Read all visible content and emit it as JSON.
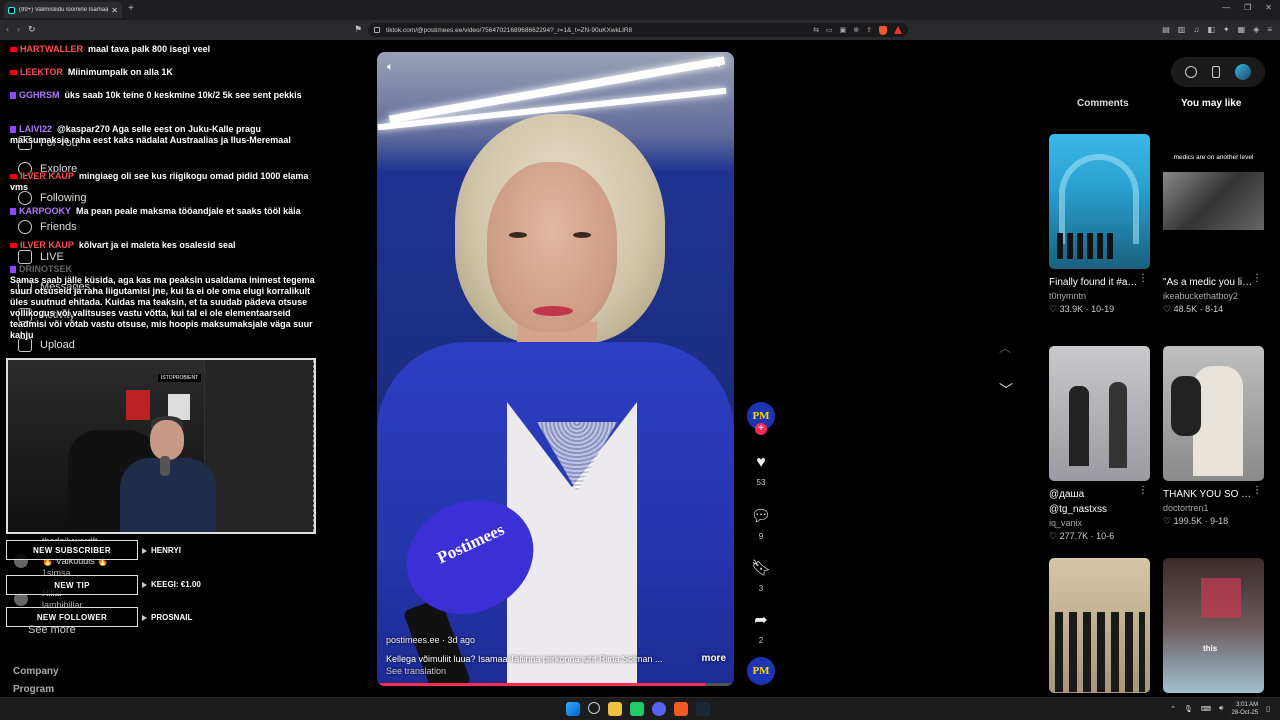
{
  "browser": {
    "tab_title": "(99+) Valimisliidu loomine Isamaa...",
    "url": "tiktok.com/@postimees.ee/video/7564702168968662294?_r=1&_t=ZN-90uKXwkLlR8"
  },
  "sidebar": {
    "items": [
      "For You",
      "Explore",
      "Following",
      "Friends",
      "LIVE",
      "Messages",
      "Activity",
      "Upload"
    ],
    "see_more": "See more",
    "footer": [
      "Company",
      "Program"
    ]
  },
  "chat": [
    {
      "user": "HARTWALLER",
      "text": "maal tava palk 800 isegi veel",
      "platform": "youtube",
      "color": "red"
    },
    {
      "user": "LEEKTOR",
      "text": "Miinimumpalk on alla 1K",
      "platform": "youtube",
      "color": "red"
    },
    {
      "user": "GGHRSM",
      "text": "üks saab 10k teine 0 keskmine 10k/2 5k see sent pekkis",
      "platform": "twitch",
      "color": "purple"
    },
    {
      "user": "LAIVI22",
      "text": "@kaspar270 Aga selle eest on Juku-Kalle pragu maksumaksja raha eest kaks nädalat Austraalias ja Ilus-Meremaal",
      "platform": "twitch",
      "color": "purple"
    },
    {
      "user": "ILVER KAUP",
      "text": "mingiaeg oli see kus riigikogu omad pidid 1000 elama vms",
      "platform": "youtube",
      "color": "red"
    },
    {
      "user": "KARPOOKY",
      "text": "Ma pean peale maksma tööandjale et saaks tööl käia",
      "platform": "twitch",
      "color": "purple"
    },
    {
      "user": "ILVER KAUP",
      "text": "kõlvart ja ei maleta kes osalesid seal",
      "platform": "youtube",
      "color": "red"
    },
    {
      "user": "DRINOTSEK",
      "text": "Samas saab jälle küsida, aga kas ma peaksin usaldama inimest tegema suuri otsuseid ja raha liigutamisi jne, kui ta ei ole oma elugi korralikult üles suutnud ehitada. Kuidas ma teaksin, et ta suudab pädeva otsuse vollikogus või valitsuses vastu võtta, kui tal ei ole elementaarseid teadmisi või võtab vastu otsuse, mis hoopis maksumaksjale väga suur kahju",
      "platform": "twitch",
      "color": "dim"
    }
  ],
  "webcam": {
    "sign": "ISTOPROBIENT"
  },
  "alerts": [
    {
      "label": "NEW SUBSCRIBER",
      "value": "HENRYI"
    },
    {
      "label": "NEW TIP",
      "value": "KEEGI: €1.00"
    },
    {
      "label": "NEW FOLLOWER",
      "value": "PROSNAIL"
    }
  ],
  "under_alerts": [
    "thedailywordft",
    "🔥 Välkuudis 🔥",
    "1simsa",
    "Hillar",
    "lambihillar"
  ],
  "video": {
    "author": "postimees.ee · 3d ago",
    "description": "Kellega võimuliit luua? Isamaa Tallinna piirkonna juht Riina Solman ...",
    "more": "more",
    "see_translation": "See translation",
    "mic_text": "Postimees",
    "avatar_text": "PM",
    "progress": 0.92
  },
  "actions": {
    "likes": "53",
    "comments": "9",
    "saves": "3",
    "shares": "2"
  },
  "right_panel": {
    "tabs": [
      "Comments",
      "You may like"
    ],
    "cards": [
      {
        "title": "Finally found it #agartha #fyp...",
        "user": "t0nymntn",
        "meta": "♡ 33.9K · 10-19"
      },
      {
        "title": "\"As a medic you live your whole li...",
        "user": "ikeabuckethatboy2",
        "meta": "♡ 48.5K · 8-14",
        "overlay": "medics are on another level"
      },
      {
        "title": "@даша",
        "title2": "@tg_nastxss",
        "user": "iq_vanix",
        "meta": "♡ 277.7K · 10-6"
      },
      {
        "title": "THANK YOU SO MUCH LARRY 😢...",
        "user": "doctortren1",
        "meta": "♡ 199.5K · 9-18"
      },
      {
        "title": "",
        "user": "",
        "meta": ""
      },
      {
        "title": "",
        "user": "",
        "meta": "",
        "overlay": "this"
      }
    ]
  },
  "taskbar": {
    "time": "3:01 AM",
    "date": "28-Oct-25"
  },
  "colors": {
    "accent": "#fe2c55",
    "brave": "#f15a24",
    "twitch": "#9146ff",
    "youtube": "#ff0000"
  }
}
